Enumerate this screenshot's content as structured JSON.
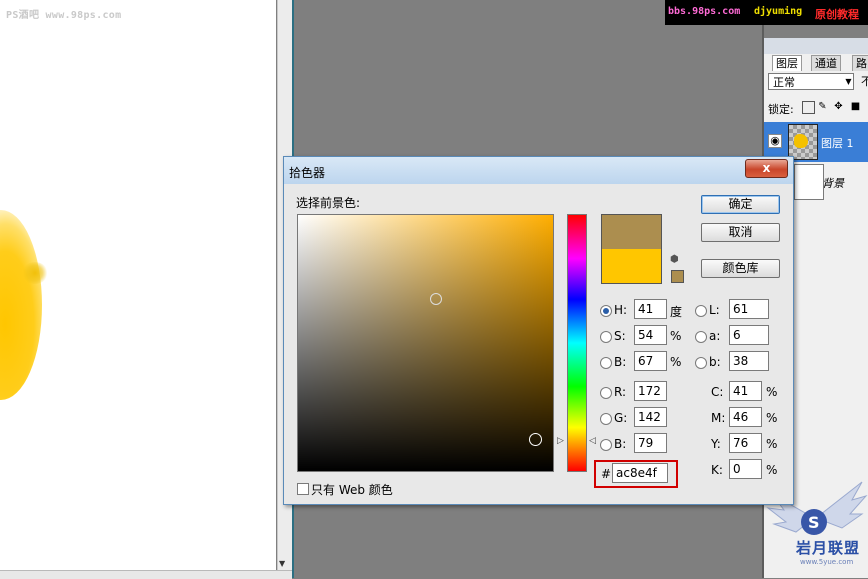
{
  "watermark_left": "PS酒吧 www.98ps.com",
  "banner": {
    "site": "bbs.98ps.com",
    "author": "djyuming",
    "tag": "原创教程"
  },
  "layers_panel": {
    "tabs": [
      "图层",
      "通道",
      "路"
    ],
    "blend_mode": "正常",
    "opacity_cut": "不",
    "lock_label": "锁定:",
    "layers": [
      {
        "name": "图层 1",
        "selected": true
      },
      {
        "name": "背景",
        "selected": false
      }
    ]
  },
  "logo": {
    "text": "岩月联盟",
    "url": "www.5yue.com"
  },
  "dialog": {
    "title": "拾色器",
    "close_label": "x",
    "prompt": "选择前景色:",
    "buttons": {
      "ok": "确定",
      "cancel": "取消",
      "library": "颜色库"
    },
    "new_color": "#ac8e4f",
    "old_color": "#ffc600",
    "hsb": [
      {
        "label": "H:",
        "value": "41",
        "unit": "度",
        "selected": true
      },
      {
        "label": "S:",
        "value": "54",
        "unit": "%",
        "selected": false
      },
      {
        "label": "B:",
        "value": "67",
        "unit": "%",
        "selected": false
      }
    ],
    "rgb": [
      {
        "label": "R:",
        "value": "172"
      },
      {
        "label": "G:",
        "value": "142"
      },
      {
        "label": "B:",
        "value": "79"
      }
    ],
    "lab": [
      {
        "label": "L:",
        "value": "61"
      },
      {
        "label": "a:",
        "value": "6"
      },
      {
        "label": "b:",
        "value": "38"
      }
    ],
    "cmyk": [
      {
        "label": "C:",
        "value": "41",
        "unit": "%"
      },
      {
        "label": "M:",
        "value": "46",
        "unit": "%"
      },
      {
        "label": "Y:",
        "value": "76",
        "unit": "%"
      },
      {
        "label": "K:",
        "value": "0",
        "unit": "%"
      }
    ],
    "hex_label": "#",
    "hex_value": "ac8e4f",
    "web_only_label": "只有 Web 颜色",
    "web_only_checked": false
  }
}
